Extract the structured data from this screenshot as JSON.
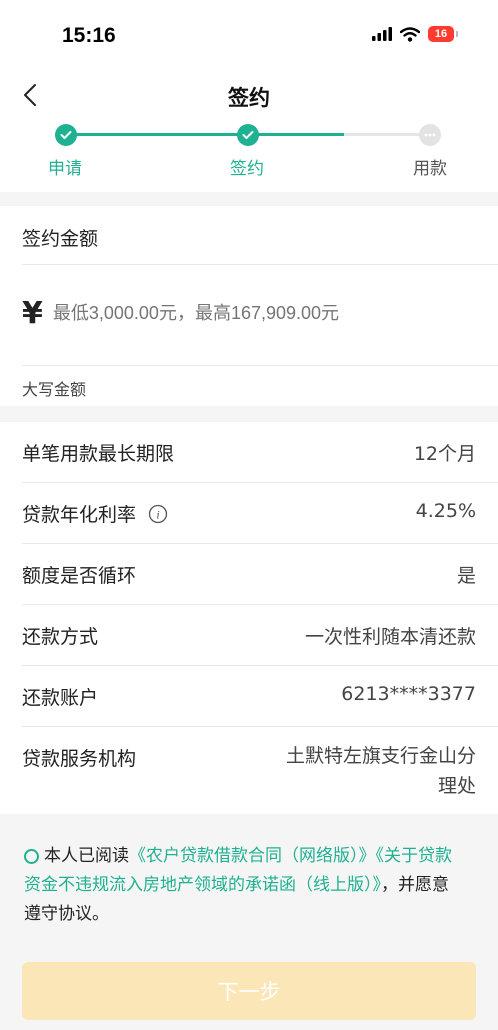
{
  "status_bar": {
    "time": "15:16",
    "battery": "16",
    "battery_color": "#ff3b30"
  },
  "header": {
    "title": "签约"
  },
  "steps": [
    {
      "label": "申请",
      "state": "done"
    },
    {
      "label": "签约",
      "state": "current"
    },
    {
      "label": "用款",
      "state": "pending"
    }
  ],
  "amount": {
    "section_label": "签约金额",
    "currency_symbol": "¥",
    "placeholder": "最低3,000.00元，最高167,909.00元",
    "uppercase_label": "大写金额"
  },
  "details": [
    {
      "label": "单笔用款最长期限",
      "value": "12个月"
    },
    {
      "label": "贷款年化利率",
      "value": "4.25%"
    },
    {
      "label": "额度是否循环",
      "value": "是"
    },
    {
      "label": "还款方式",
      "value": "一次性利随本清还款"
    },
    {
      "label": "还款账户",
      "value": "6213****3377"
    },
    {
      "label": "贷款服务机构",
      "value_line1": "土默特左旗支行金山分",
      "value_line2": "理处"
    }
  ],
  "agreement": {
    "prefix": "本人已阅读",
    "link1": "《农户贷款借款合同（网络版）》",
    "link2": "《关于贷款资金不违规流入房地产领域的承诺函（线上版）》",
    "suffix": "，并愿意遵守协议。"
  },
  "next_button": {
    "label": "下一步"
  },
  "colors": {
    "accent": "#1fb191",
    "button_disabled": "#fbe6b8"
  }
}
